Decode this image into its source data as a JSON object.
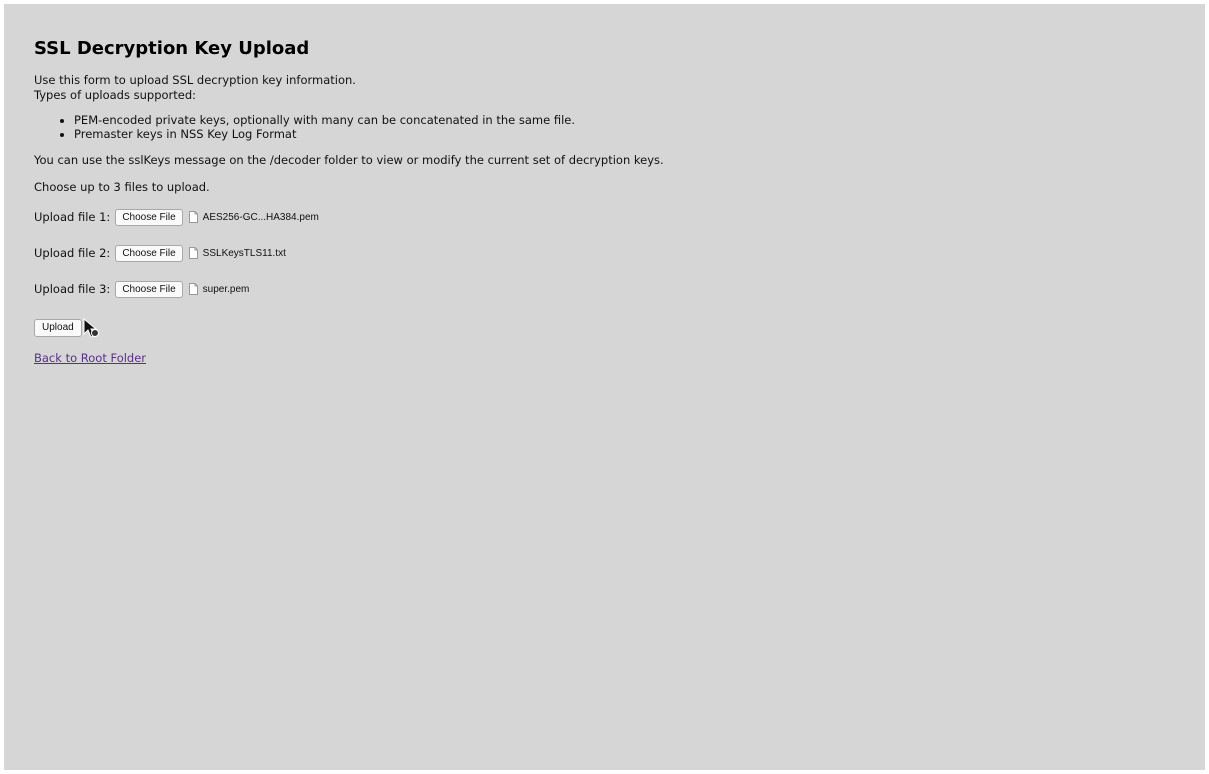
{
  "page": {
    "title": "SSL Decryption Key Upload",
    "intro_line1": "Use this form to upload SSL decryption key information.",
    "intro_line2": "Types of uploads supported:",
    "upload_types": [
      "PEM-encoded private keys, optionally with many can be concatenated in the same file.",
      "Premaster keys in NSS Key Log Format"
    ],
    "info": "You can use the sslKeys message on the /decoder folder to view or modify the current set of decryption keys.",
    "instruction": "Choose up to 3 files to upload."
  },
  "uploads": [
    {
      "label": "Upload file 1:",
      "button_label": "Choose File",
      "file_name": "AES256-GC...HA384.pem"
    },
    {
      "label": "Upload file 2:",
      "button_label": "Choose File",
      "file_name": "SSLKeysTLS11.txt"
    },
    {
      "label": "Upload file 3:",
      "button_label": "Choose File",
      "file_name": "super.pem"
    }
  ],
  "actions": {
    "upload_label": "Upload",
    "back_link": "Back to Root Folder"
  },
  "icons": {
    "file": "file-icon",
    "cursor": "busy-cursor-icon"
  },
  "colors": {
    "background": "#d6d6d6",
    "link": "#5b2d8e"
  }
}
